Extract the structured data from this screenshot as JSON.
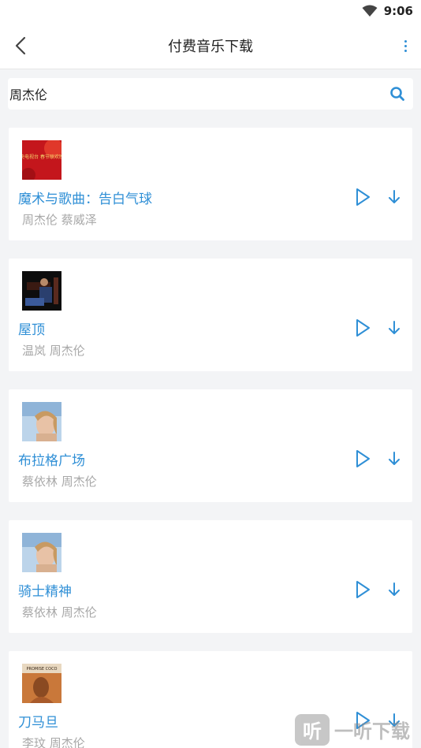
{
  "status_bar": {
    "time": "9:06"
  },
  "header": {
    "title": "付费音乐下载"
  },
  "search": {
    "value": "周杰伦"
  },
  "songs": [
    {
      "title": "魔术与歌曲：告白气球",
      "artist": "周杰伦 蔡威泽",
      "art_caption": "中央电视台 春节联欢晚会"
    },
    {
      "title": "屋顶",
      "artist": "温岚 周杰伦"
    },
    {
      "title": "布拉格广场",
      "artist": "蔡依林 周杰伦"
    },
    {
      "title": "骑士精神",
      "artist": "蔡依林 周杰伦"
    },
    {
      "title": "刀马旦",
      "artist": "李玟 周杰伦",
      "art_caption": "PROMISE COCO"
    }
  ],
  "watermark": {
    "text": "一听下载",
    "logo_char": "听"
  },
  "colors": {
    "accent": "#2f8fd6",
    "background": "#f3f4f6",
    "muted": "#a8a8a8"
  }
}
